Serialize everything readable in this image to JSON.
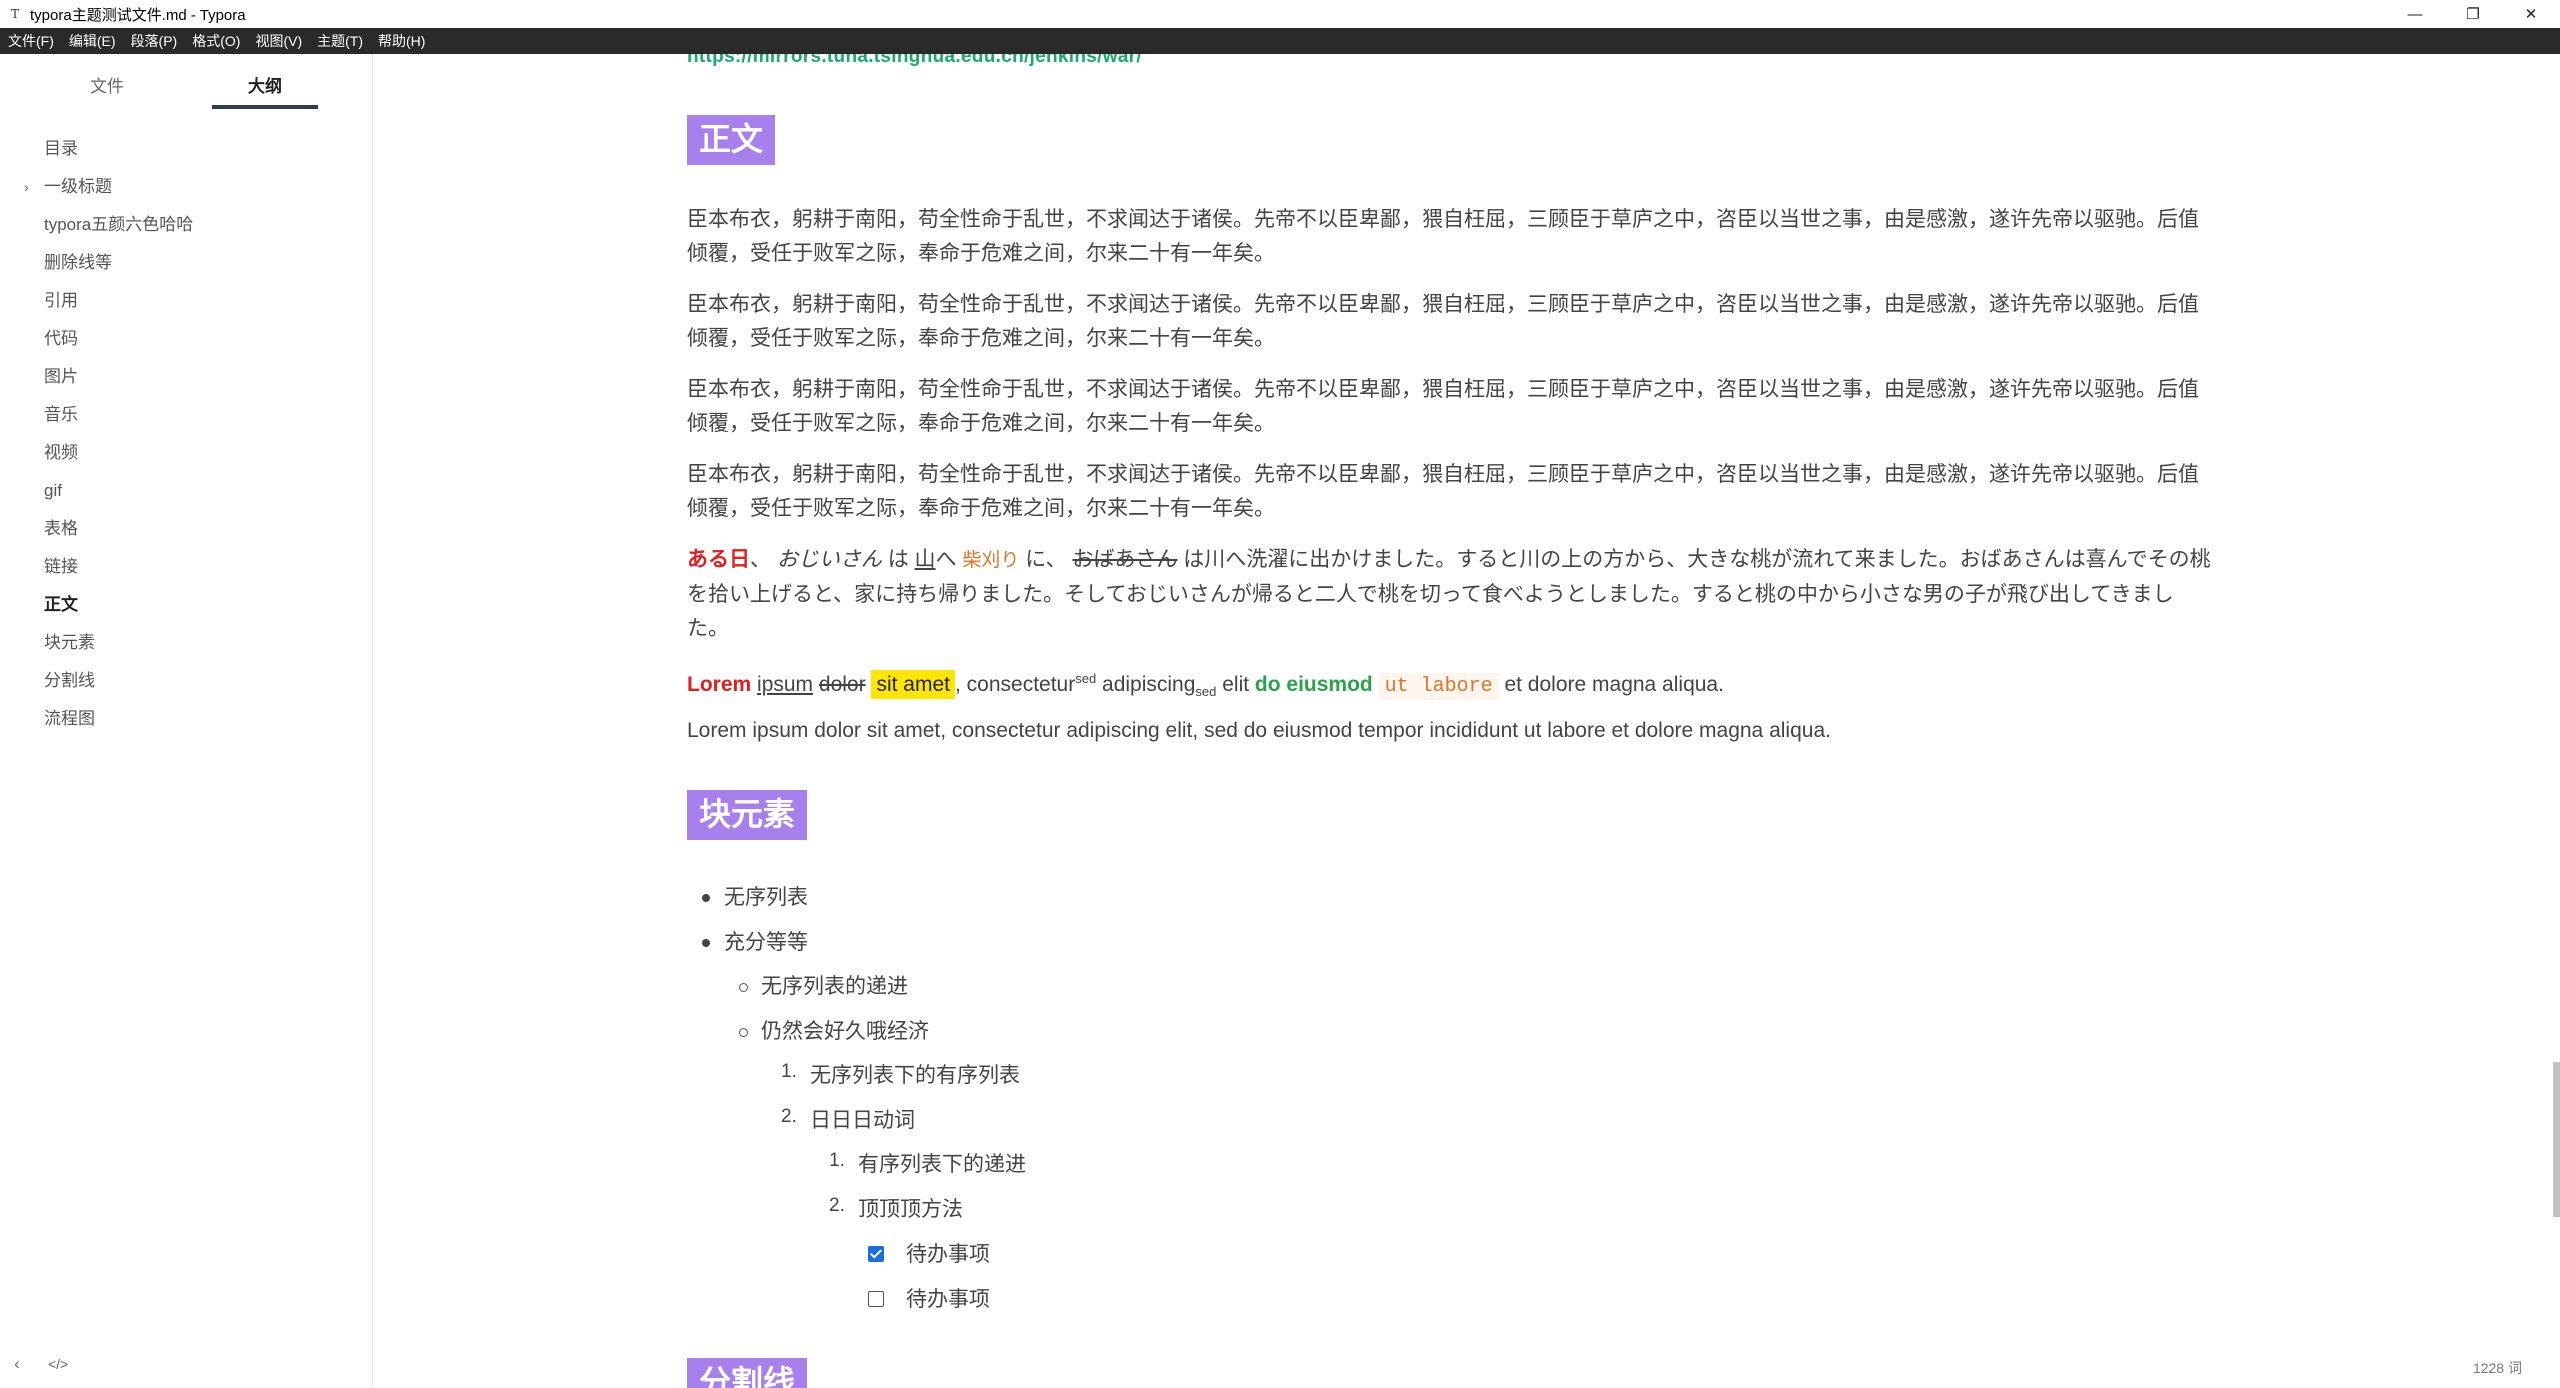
{
  "window": {
    "icon_glyph": "T",
    "title": "typora主题测试文件.md - Typora",
    "controls": {
      "minimize": "—",
      "maximize": "❐",
      "close": "✕"
    }
  },
  "menu": [
    "文件(F)",
    "编辑(E)",
    "段落(P)",
    "格式(O)",
    "视图(V)",
    "主题(T)",
    "帮助(H)"
  ],
  "sidebar": {
    "tabs": {
      "files": "文件",
      "outline": "大纲"
    },
    "outline": [
      {
        "label": "目录",
        "expandable": false,
        "active": false
      },
      {
        "label": "一级标题",
        "expandable": true,
        "active": false
      },
      {
        "label": "typora五颜六色哈哈",
        "expandable": false,
        "active": false
      },
      {
        "label": "删除线等",
        "expandable": false,
        "active": false
      },
      {
        "label": "引用",
        "expandable": false,
        "active": false
      },
      {
        "label": "代码",
        "expandable": false,
        "active": false
      },
      {
        "label": "图片",
        "expandable": false,
        "active": false
      },
      {
        "label": "音乐",
        "expandable": false,
        "active": false
      },
      {
        "label": "视频",
        "expandable": false,
        "active": false
      },
      {
        "label": "gif",
        "expandable": false,
        "active": false
      },
      {
        "label": "表格",
        "expandable": false,
        "active": false
      },
      {
        "label": "链接",
        "expandable": false,
        "active": false
      },
      {
        "label": "正文",
        "expandable": false,
        "active": true
      },
      {
        "label": "块元素",
        "expandable": false,
        "active": false
      },
      {
        "label": "分割线",
        "expandable": false,
        "active": false
      },
      {
        "label": "流程图",
        "expandable": false,
        "active": false
      }
    ],
    "caret_icon": "›",
    "footer": {
      "back_icon": "‹",
      "source_icon": "</>"
    }
  },
  "editor": {
    "top_link": "https://mirrors.tuna.tsinghua.edu.cn/jenkins/war/",
    "heading_body": "正文",
    "body_paragraph_line1": "臣本布衣，躬耕于南阳，苟全性命于乱世，不求闻达于诸侯。先帝不以臣卑鄙，猥自枉屈，三顾臣于草庐之中，咨臣以当世之事，由是感激，遂许先帝以驱驰。后值",
    "body_paragraph_line2": "倾覆，受任于败军之际，奉命于危难之间，尔来二十有一年矣。",
    "jp": {
      "aru_hi": "ある日",
      "comma": "、",
      "ojiisan": "おじいさん",
      "wa": "は",
      "yama": "山",
      "he": "へ",
      "shibakari": "柴刈り",
      "ni": "に、",
      "obaasan": "おばあさん",
      "rest_line1": "は川へ洗濯に出かけました。すると川の上の方から、大きな桃が流れて来ました。おばあさんは喜んでその桃",
      "line2": "を拾い上げると、家に持ち帰りました。そしておじいさんが帰ると二人で桃を切って食べようとしました。すると桃の中から小さな男の子が飛び出してきまし",
      "line3": "た。"
    },
    "lorem_styled": {
      "lorem": "Lorem",
      "ipsum": "ipsum",
      "dolor": "dolor",
      "sit_amet": "sit amet",
      "consectetur": ", consectetur",
      "sup": "sed",
      "adipiscing": " adipiscing",
      "sub": "sed",
      "elit": " elit ",
      "do_eiusmod": "do eiusmod",
      "ut_labore": "ut labore",
      "tail": " et dolore magna aliqua."
    },
    "lorem_plain": "Lorem ipsum dolor sit amet, consectetur adipiscing elit, sed do eiusmod tempor incididunt ut labore et dolore magna aliqua.",
    "heading_block": "块元素",
    "list": {
      "ul1": "无序列表",
      "ul2": "充分等等",
      "ul2_1": "无序列表的递进",
      "ul2_2": "仍然会好久哦经济",
      "ol1_num": "1.",
      "ol1": "无序列表下的有序列表",
      "ol2_num": "2.",
      "ol2": "日日日动词",
      "ol2_1_num": "1.",
      "ol2_1": "有序列表下的递进",
      "ol2_2_num": "2.",
      "ol2_2": "顶顶顶方法",
      "todo1": {
        "label": "待办事项",
        "checked": true
      },
      "todo2": {
        "label": "待办事项",
        "checked": false
      }
    },
    "heading_divider": "分割线"
  },
  "status": {
    "word_count": "1228 词"
  },
  "colors": {
    "heading_badge": "#a880ee",
    "link": "#1aaa6a",
    "menubar": "#2a2a2a",
    "highlight": "#ffe600",
    "red": "#e02020",
    "green": "#2aa24a"
  }
}
